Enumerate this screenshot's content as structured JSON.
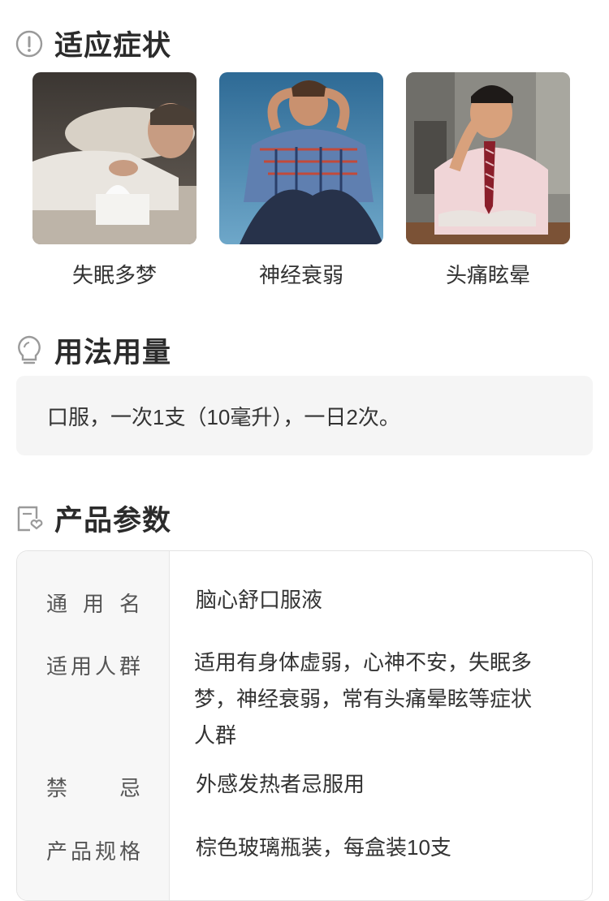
{
  "sections": {
    "symptoms_title": "适应症状",
    "usage_title": "用法用量",
    "params_title": "产品参数"
  },
  "symptoms": [
    {
      "label": "失眠多梦"
    },
    {
      "label": "神经衰弱"
    },
    {
      "label": "头痛眩晕"
    }
  ],
  "usage": {
    "text": "口服，一次1支（10毫升），一日2次。"
  },
  "params": [
    {
      "label_chars": [
        "通",
        "用",
        "名"
      ],
      "value": "脑心舒口服液"
    },
    {
      "label_chars": [
        "适",
        "用",
        "人",
        "群"
      ],
      "value": "适用有身体虚弱，心神不安，失眠多梦，神经衰弱，常有头痛晕眩等症状人群"
    },
    {
      "label_chars": [
        "禁",
        "忌"
      ],
      "value": "外感发热者忌服用"
    },
    {
      "label_chars": [
        "产",
        "品",
        "规",
        "格"
      ],
      "value": "棕色玻璃瓶装，每盒装10支"
    }
  ],
  "icons": {
    "symptoms": "exclamation-circle-icon",
    "usage": "lightbulb-icon",
    "params": "certificate-heart-icon"
  }
}
